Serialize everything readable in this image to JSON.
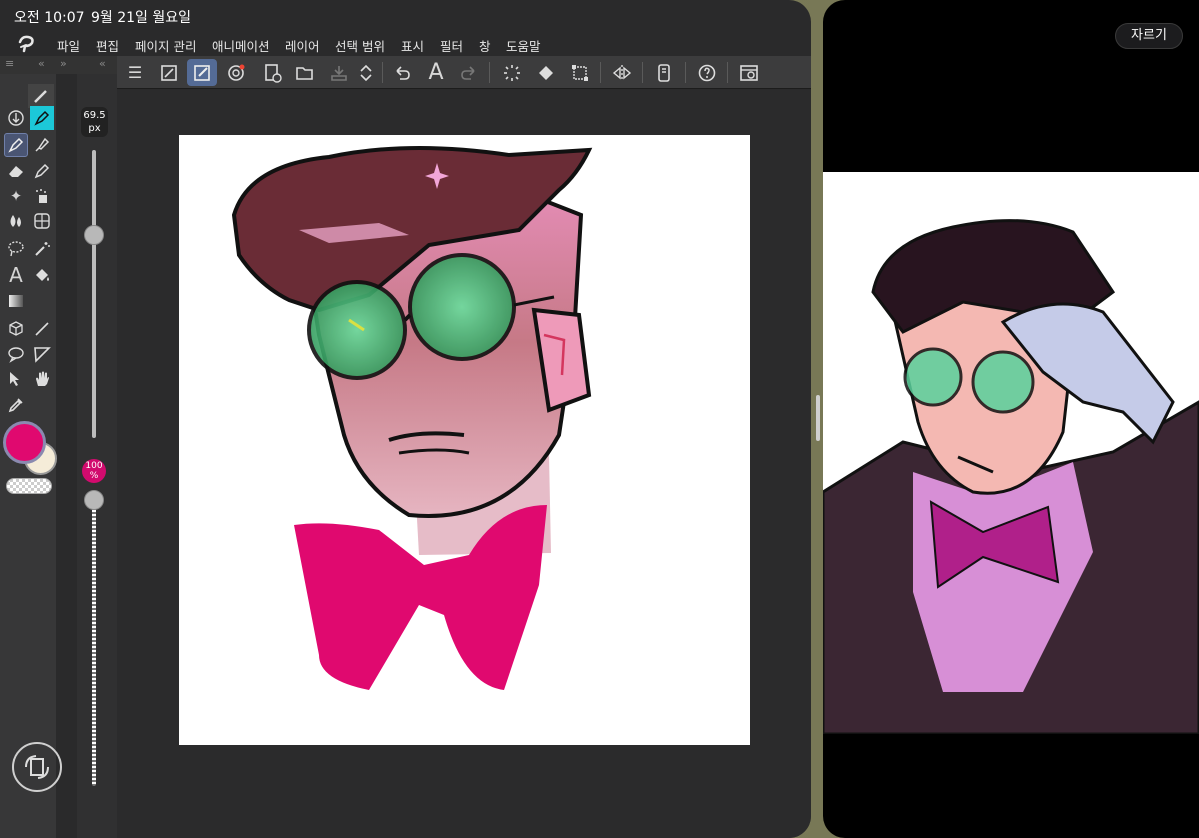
{
  "status": {
    "time": "오전 10:07",
    "date": "9월 21일 월요일"
  },
  "menu": [
    "파일",
    "편집",
    "페이지 관리",
    "애니메이션",
    "레이어",
    "선택 범위",
    "표시",
    "필터",
    "창",
    "도움말"
  ],
  "brush": {
    "size_value": "69.5",
    "size_unit": "px",
    "size_level": 0.72
  },
  "opacity": {
    "value": "100",
    "unit": "%",
    "level": 1.0
  },
  "colors": {
    "main": "#e0096f",
    "sub": "#f5ecd8",
    "accent": "#546b96",
    "bowtie": "#e0096f"
  },
  "viewer": {
    "crop_label": "자르기"
  },
  "toolbar_icons": [
    "menu-icon",
    "fit-icon",
    "brush-edit-icon",
    "record-icon",
    "new-canvas-icon",
    "open-icon",
    "save-icon",
    "updown-icon",
    "undo-icon",
    "text-icon",
    "redo-icon",
    "loading-icon",
    "fill-icon",
    "transform-icon",
    "flip-icon",
    "device-icon",
    "help-icon",
    "settings-icon"
  ],
  "panel_collapse": [
    "≡",
    "«",
    "»",
    "«",
    "≡",
    "«"
  ]
}
